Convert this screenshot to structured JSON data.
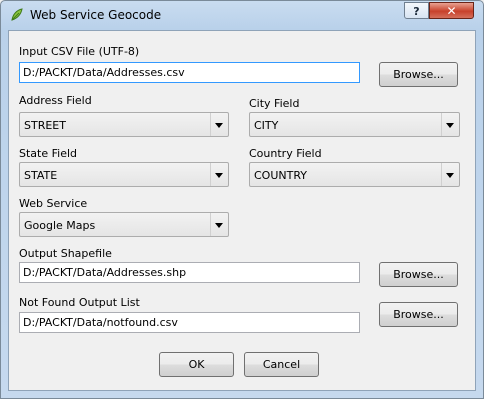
{
  "window": {
    "title": "Web Service Geocode",
    "help_label": "?",
    "close_label": "✕"
  },
  "input_csv": {
    "label": "Input CSV File (UTF-8)",
    "value": "D:/PACKT/Data/Addresses.csv",
    "browse_label": "Browse..."
  },
  "address_field": {
    "label": "Address Field",
    "value": "STREET"
  },
  "city_field": {
    "label": "City Field",
    "value": "CITY"
  },
  "state_field": {
    "label": "State Field",
    "value": "STATE"
  },
  "country_field": {
    "label": "Country Field",
    "value": "COUNTRY"
  },
  "web_service": {
    "label": "Web Service",
    "value": "Google Maps"
  },
  "output_shapefile": {
    "label": "Output Shapefile",
    "value": "D:/PACKT/Data/Addresses.shp",
    "browse_label": "Browse..."
  },
  "not_found": {
    "label": "Not Found Output List",
    "value": "D:/PACKT/Data/notfound.csv",
    "browse_label": "Browse..."
  },
  "buttons": {
    "ok_label": "OK",
    "cancel_label": "Cancel"
  },
  "colors": {
    "title_bar": "#b9d1ea",
    "close_button": "#c8412b",
    "focus_border": "#3399ff",
    "app_icon": "#5a9e2f"
  },
  "icons": {
    "app": "qgis-leaf-icon",
    "close": "close-icon",
    "help": "help-icon",
    "dropdown": "chevron-down-icon"
  }
}
